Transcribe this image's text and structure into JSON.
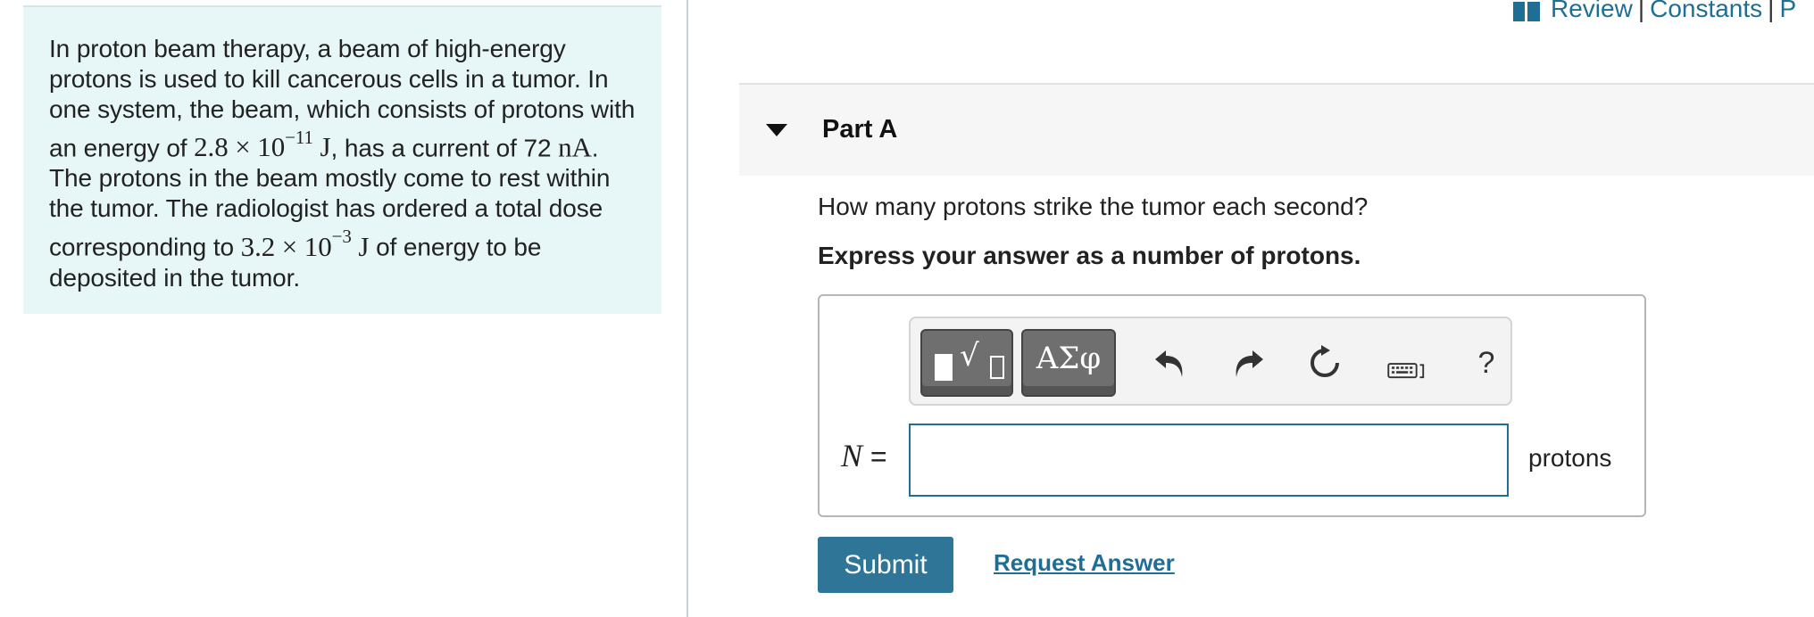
{
  "header": {
    "links": [
      "Review",
      "Constants",
      "P"
    ],
    "separator": "|"
  },
  "problem": {
    "text_1": "In proton beam therapy, a beam of high-energy protons is used to kill cancerous cells in a tumor. In one system, the beam, which consists of protons with an energy of ",
    "energy_mantissa": "2.8 × 10",
    "energy_exponent": "−11",
    "energy_unit": " J",
    "text_2": ", has a current of 72 ",
    "current_unit": "nA",
    "text_3": ". The protons in the beam mostly come to rest within the tumor. The radiologist has ordered a total dose corresponding to ",
    "dose_mantissa": "3.2 × 10",
    "dose_exponent": "−3",
    "dose_unit": " J",
    "text_4": " of energy to be deposited in the tumor."
  },
  "part": {
    "title": "Part A",
    "question": "How many protons strike the tumor each second?",
    "instruction": "Express your answer as a number of protons."
  },
  "toolbar": {
    "templates_icon": "templates-icon",
    "symbols_label": "ΑΣφ",
    "help_label": "?"
  },
  "answer": {
    "variable": "N",
    "equals": " =",
    "value": "",
    "unit": "protons"
  },
  "actions": {
    "submit_label": "Submit",
    "request_label": "Request Answer"
  },
  "colors": {
    "accent": "#1f6e95",
    "submit_bg": "#2f7598",
    "problem_bg": "#e7f6f6"
  }
}
